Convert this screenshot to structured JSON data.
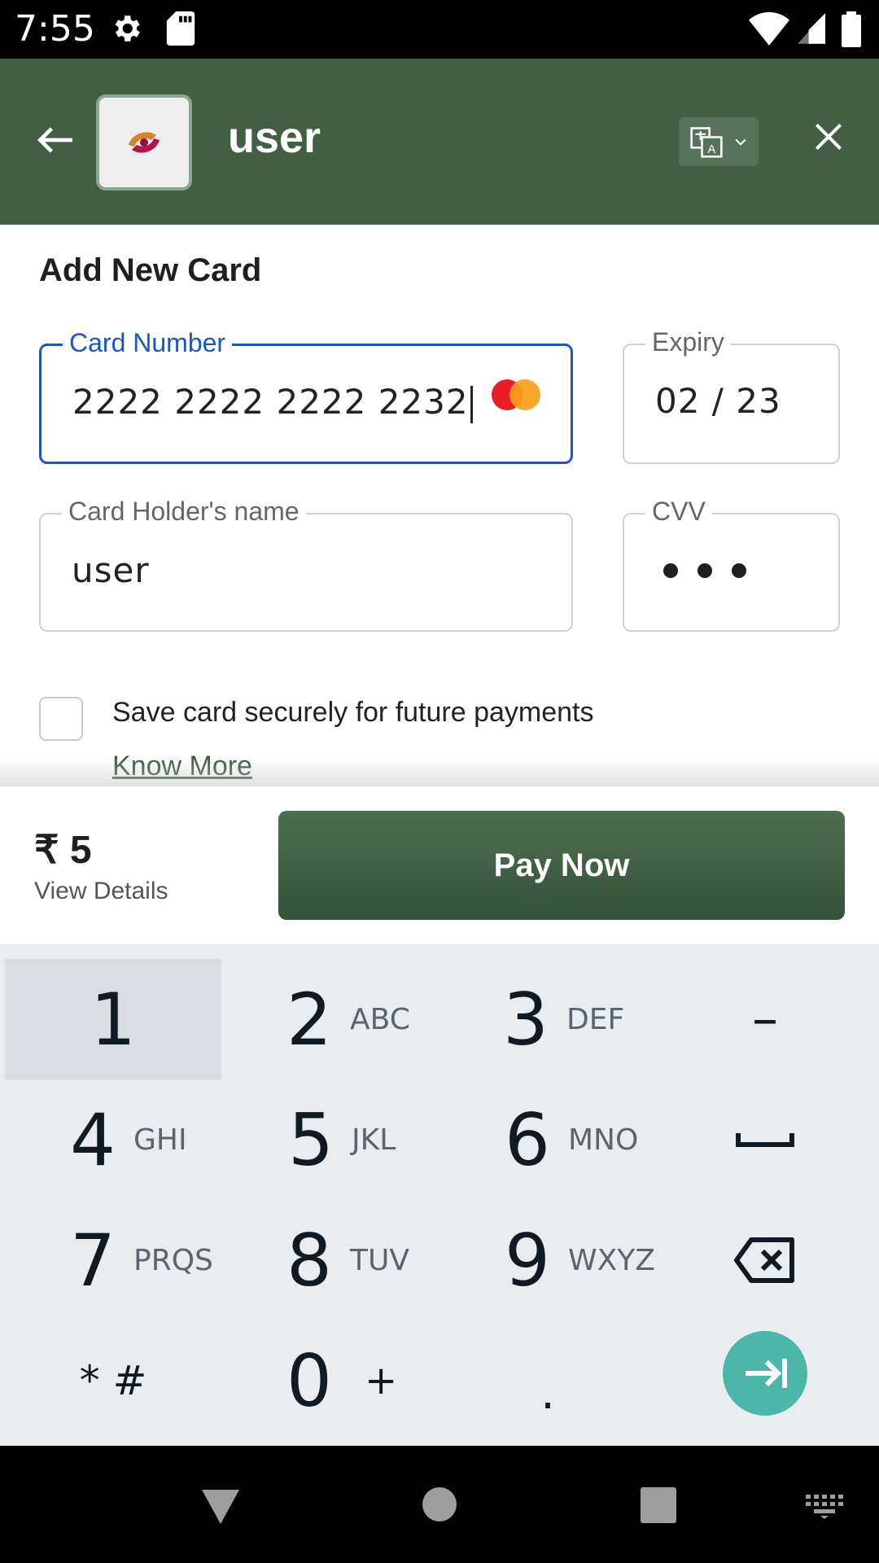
{
  "status_bar": {
    "time": "7:55",
    "icons": [
      "settings-icon",
      "sd-card-icon",
      "wifi-icon",
      "signal-icon",
      "battery-icon"
    ]
  },
  "header": {
    "merchant_name": "user",
    "logo": "merchant-logo",
    "icons": [
      "back-arrow-icon",
      "translate-icon",
      "chevron-down-icon",
      "close-icon"
    ],
    "background_color": "#425f44"
  },
  "form": {
    "title": "Add New Card",
    "card_number": {
      "label": "Card Number",
      "value": "2222 2222 2222 2232",
      "brand_icon": "mastercard-icon"
    },
    "expiry": {
      "label": "Expiry",
      "value": "02 / 23"
    },
    "holder_name": {
      "label": "Card Holder's name",
      "value": "user"
    },
    "cvv": {
      "label": "CVV",
      "masked_digits": 3
    },
    "save_card": {
      "label": "Save card securely for future payments",
      "checked": false
    },
    "know_more": "Know More"
  },
  "payment": {
    "amount": "₹ 5",
    "view_details": "View Details",
    "pay_button": "Pay Now"
  },
  "keypad": {
    "keys": [
      {
        "digit": "1",
        "letters": ""
      },
      {
        "digit": "2",
        "letters": "ABC"
      },
      {
        "digit": "3",
        "letters": "DEF"
      },
      {
        "digit": "–",
        "letters": ""
      },
      {
        "digit": "4",
        "letters": "GHI"
      },
      {
        "digit": "5",
        "letters": "JKL"
      },
      {
        "digit": "6",
        "letters": "MNO"
      },
      {
        "digit": "7",
        "letters": "PRQS"
      },
      {
        "digit": "8",
        "letters": "TUV"
      },
      {
        "digit": "9",
        "letters": "WXYZ"
      },
      {
        "digit": "* #",
        "letters": ""
      },
      {
        "digit": "0",
        "letters": "+"
      },
      {
        "digit": ".",
        "letters": ""
      }
    ],
    "icons": [
      "space-icon",
      "backspace-icon",
      "enter-icon"
    ],
    "accent_color": "#4cb6a9"
  },
  "nav_bar": {
    "icons": [
      "back-triangle-icon",
      "home-circle-icon",
      "recents-square-icon",
      "keyboard-icon"
    ]
  }
}
